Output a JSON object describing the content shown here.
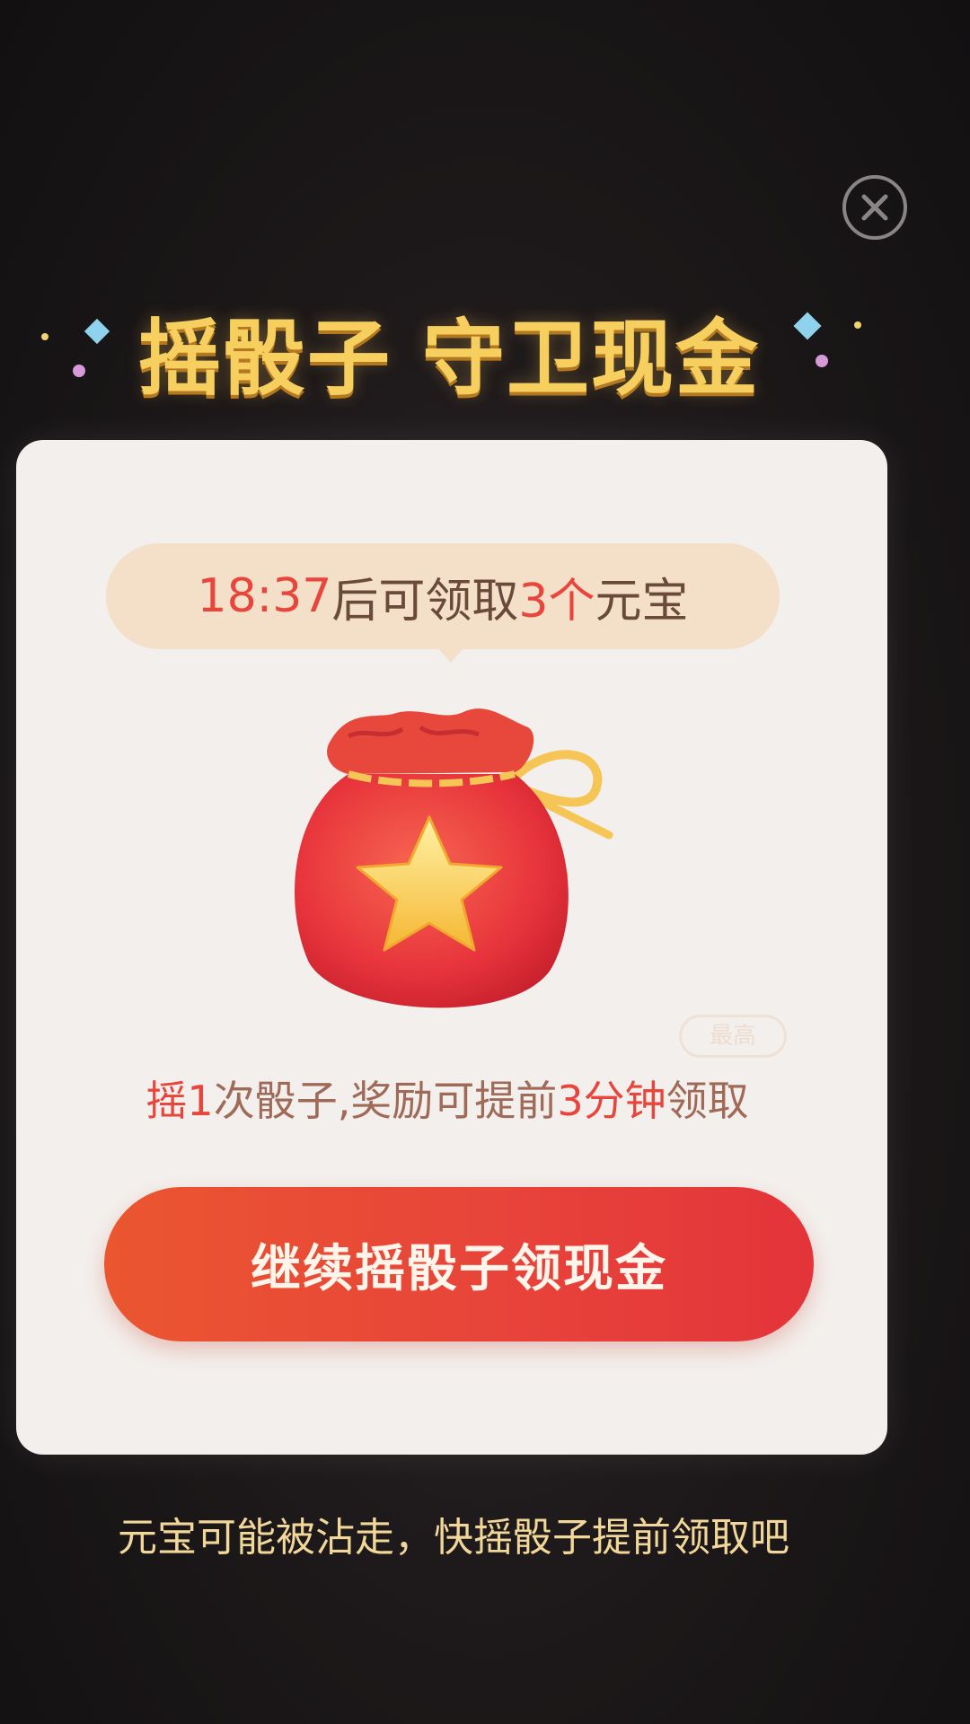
{
  "close_icon": "close-x-icon",
  "headline": "摇骰子 守卫现金",
  "timer": {
    "countdown": "18:37",
    "text_after_countdown": "后可领取",
    "count": "3个",
    "unit": "元宝"
  },
  "reward_bag_icon": "red-lucky-bag-star-icon",
  "badge_label": "最高",
  "reward_line": {
    "part1": "摇",
    "count": "1",
    "part2": "次骰子,奖励可提前",
    "minutes": "3分钟",
    "part3": "领取"
  },
  "cta_label": "继续摇骰子领现金",
  "footer_hint": "元宝可能被沾走，快摇骰子提前领取吧",
  "colors": {
    "highlight_red": "#e8453c",
    "headline_gold": "#f6cf5f",
    "cta_start": "#ea5630",
    "cta_end": "#e3343a",
    "card_bg": "#f3efec",
    "pill_bg": "#f4dfc9"
  }
}
